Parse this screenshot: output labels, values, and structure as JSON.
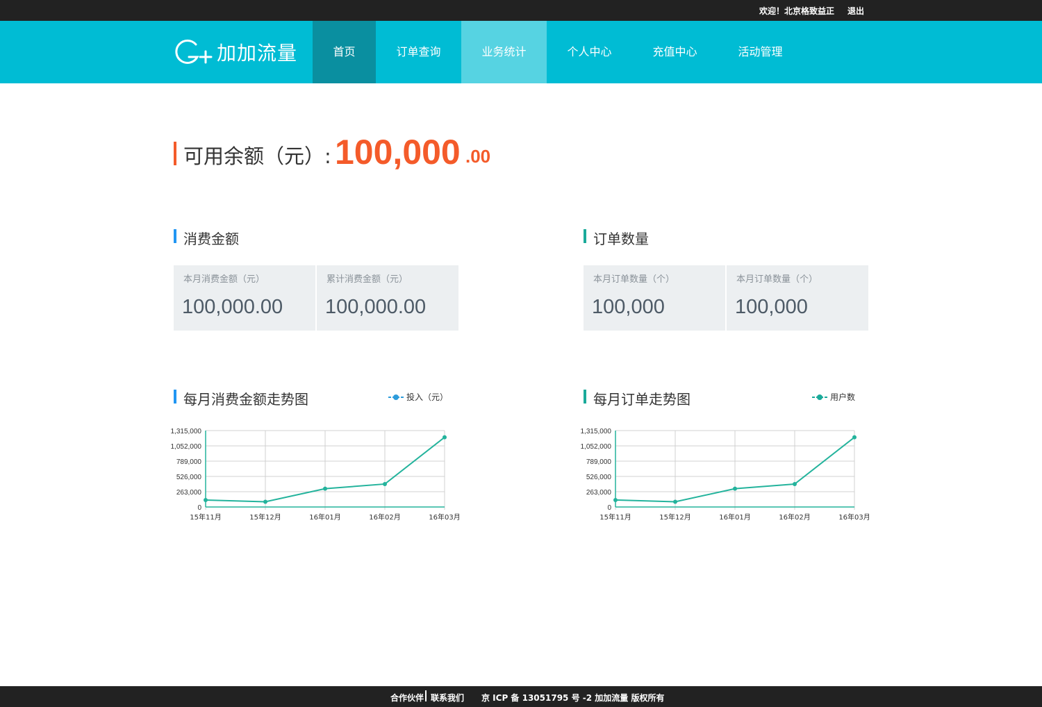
{
  "topbar": {
    "welcome": "欢迎！北京格致益正",
    "logout": "退出"
  },
  "logo": {
    "text": "加加流量"
  },
  "nav": {
    "items": [
      {
        "label": "首页",
        "state": "active"
      },
      {
        "label": "订单查询",
        "state": "normal"
      },
      {
        "label": "业务统计",
        "state": "hover"
      },
      {
        "label": "个人中心",
        "state": "normal"
      },
      {
        "label": "充值中心",
        "state": "normal"
      },
      {
        "label": "活动管理",
        "state": "normal"
      }
    ]
  },
  "balance": {
    "label": "可用余额（元）:",
    "amount": "100,000",
    "decimal": ".00"
  },
  "consumption": {
    "title": "消费金额",
    "cards": [
      {
        "label": "本月消费金额（元）",
        "value": "100,000.00"
      },
      {
        "label": "累计消费金额（元）",
        "value": "100,000.00"
      }
    ]
  },
  "orders": {
    "title": "订单数量",
    "cards": [
      {
        "label": "本月订单数量（个）",
        "value": "100,000"
      },
      {
        "label": "本月订单数量（个）",
        "value": "100,000"
      }
    ]
  },
  "trend_consumption": {
    "title": "每月消费金额走势图",
    "legend": "投入（元）"
  },
  "trend_orders": {
    "title": "每月订单走势图",
    "legend": "用户数"
  },
  "colors": {
    "accent": "#00bcd4",
    "orange": "#f45b2a",
    "blue_mark": "#2196f3",
    "teal_mark": "#1aaa9a",
    "line": "#23b39c",
    "legend_blue": "#2d9cdb",
    "legend_teal": "#1aaa9a"
  },
  "chart_data": [
    {
      "type": "line",
      "categories": [
        "15年11月",
        "15年12月",
        "16年01月",
        "16年02月",
        "16年03月"
      ],
      "series": [
        {
          "name": "投入（元）",
          "values": [
            120000,
            90000,
            315000,
            395000,
            1200000
          ]
        }
      ],
      "ylim": [
        0,
        1315000
      ],
      "yticks": [
        0,
        263000,
        526000,
        789000,
        1052000,
        1315000
      ],
      "ytick_labels": [
        "0",
        "263,000",
        "526,000",
        "789,000",
        "1,052,000",
        "1,315,000"
      ],
      "grid": true,
      "legend_position": "top-right"
    },
    {
      "type": "line",
      "categories": [
        "15年11月",
        "15年12月",
        "16年01月",
        "16年02月",
        "16年03月"
      ],
      "series": [
        {
          "name": "用户数",
          "values": [
            120000,
            90000,
            315000,
            395000,
            1200000
          ]
        }
      ],
      "ylim": [
        0,
        1315000
      ],
      "yticks": [
        0,
        263000,
        526000,
        789000,
        1052000,
        1315000
      ],
      "ytick_labels": [
        "0",
        "263,000",
        "526,000",
        "789,000",
        "1,052,000",
        "1,315,000"
      ],
      "grid": true,
      "legend_position": "top-right"
    }
  ],
  "footer": {
    "partners": "合作伙伴",
    "contact": "联系我们",
    "icp": "京 ICP 备 13051795 号 -2 加加流量  版权所有"
  }
}
